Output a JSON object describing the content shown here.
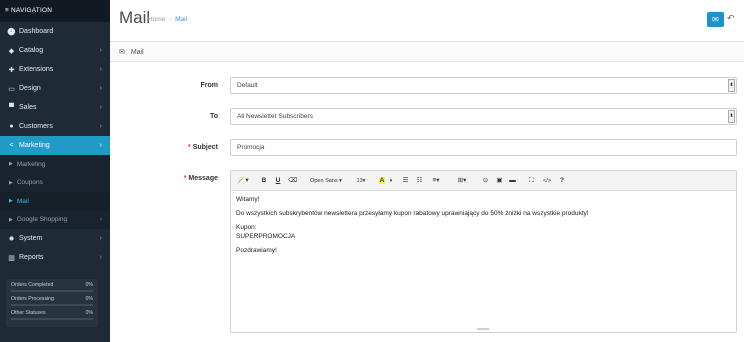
{
  "nav": {
    "header": "≡ NAVIGATION",
    "items": [
      {
        "label": "Dashboard",
        "icon": "dashboard-icon",
        "glyph": "🕘"
      },
      {
        "label": "Catalog",
        "icon": "tag-icon",
        "glyph": "◆"
      },
      {
        "label": "Extensions",
        "icon": "puzzle-icon",
        "glyph": "✚"
      },
      {
        "label": "Design",
        "icon": "monitor-icon",
        "glyph": "▭"
      },
      {
        "label": "Sales",
        "icon": "cart-icon",
        "glyph": "▀"
      },
      {
        "label": "Customers",
        "icon": "user-icon",
        "glyph": "●"
      },
      {
        "label": "Marketing",
        "icon": "share-icon",
        "glyph": "<"
      }
    ],
    "sub_items": [
      "Marketing",
      "Coupons",
      "Mail",
      "Google Shopping"
    ],
    "items_after": [
      {
        "label": "System",
        "icon": "cog-icon",
        "glyph": "✹"
      },
      {
        "label": "Reports",
        "icon": "bar-chart-icon",
        "glyph": "▥"
      }
    ],
    "chevron": "›"
  },
  "stats": [
    {
      "label": "Orders Completed",
      "value": "0%",
      "fraction": 0
    },
    {
      "label": "Orders Processing",
      "value": "0%",
      "fraction": 0
    },
    {
      "label": "Other Statuses",
      "value": "0%",
      "fraction": 0
    }
  ],
  "header": {
    "title": "Mail",
    "breadcrumb_home": "Home",
    "breadcrumb_sep": "›",
    "breadcrumb_current": "Mail",
    "send_glyph": "✉",
    "back_glyph": "↶"
  },
  "panel": {
    "title": "Mail",
    "icon_glyph": "✉"
  },
  "form": {
    "from_label": "From",
    "from_value": "Default",
    "to_label": "To",
    "to_value": "All Newsletter Subscribers",
    "subject_label": "Subject",
    "subject_value": "Promocja",
    "message_label": "Message",
    "required_mark": "*",
    "select_arrow": "⬍"
  },
  "toolbar": {
    "magic": "🪄▾",
    "bold": "B",
    "underline": "U",
    "eraser": "⌫",
    "font": "Open Sans ▾",
    "size": "13▾",
    "color": "A",
    "color_caret": "▾",
    "ul": "☰",
    "ol": "☷",
    "align": "≡▾",
    "table": "⊞▾",
    "link": "⊝",
    "image": "▣",
    "hr": "▬",
    "fullscreen": "⛶",
    "code": "</>",
    "help": "?"
  },
  "message": {
    "line1": "Witamy!",
    "line2": "Do wszystkich subskrybentów newslettera przesyłamy kupon rabatowy uprawniający do 50% zniżki na wszystkie produkty!",
    "line3a": "Kupon:",
    "line3b": "SUPERPROMOCJA",
    "line4": "Pozdrawiamy!"
  },
  "colors": {
    "accent": "#1e91cf",
    "sidebar": "#1e2a36",
    "active": "#229ac8",
    "required": "#f2341c"
  }
}
